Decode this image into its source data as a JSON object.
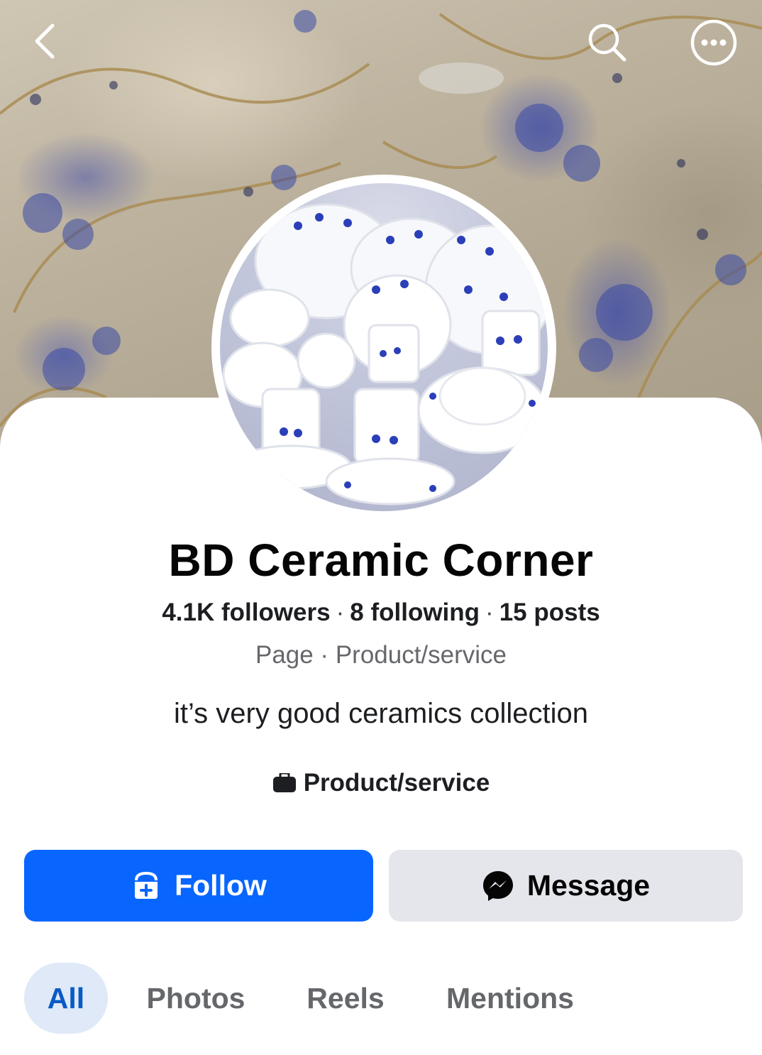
{
  "header": {
    "back_icon": "chevron-left-icon",
    "search_icon": "search-icon",
    "more_icon": "more-options-icon"
  },
  "profile": {
    "name": "BD Ceramic Corner",
    "followers": "4.1K followers",
    "following": "8 following",
    "posts": "15 posts",
    "separator": "·",
    "category_line": "Page · Product/service",
    "bio": "it’s very good ceramics collection",
    "category_tag": "Product/service"
  },
  "actions": {
    "follow_label": "Follow",
    "message_label": "Message"
  },
  "tabs": [
    {
      "label": "All",
      "active": true
    },
    {
      "label": "Photos",
      "active": false
    },
    {
      "label": "Reels",
      "active": false
    },
    {
      "label": "Mentions",
      "active": false
    }
  ],
  "colors": {
    "primary": "#0866ff",
    "secondary_button": "#e4e6eb",
    "active_tab_bg": "#dfe9f7",
    "active_tab_text": "#0a5bc4",
    "muted_text": "#65676b"
  }
}
